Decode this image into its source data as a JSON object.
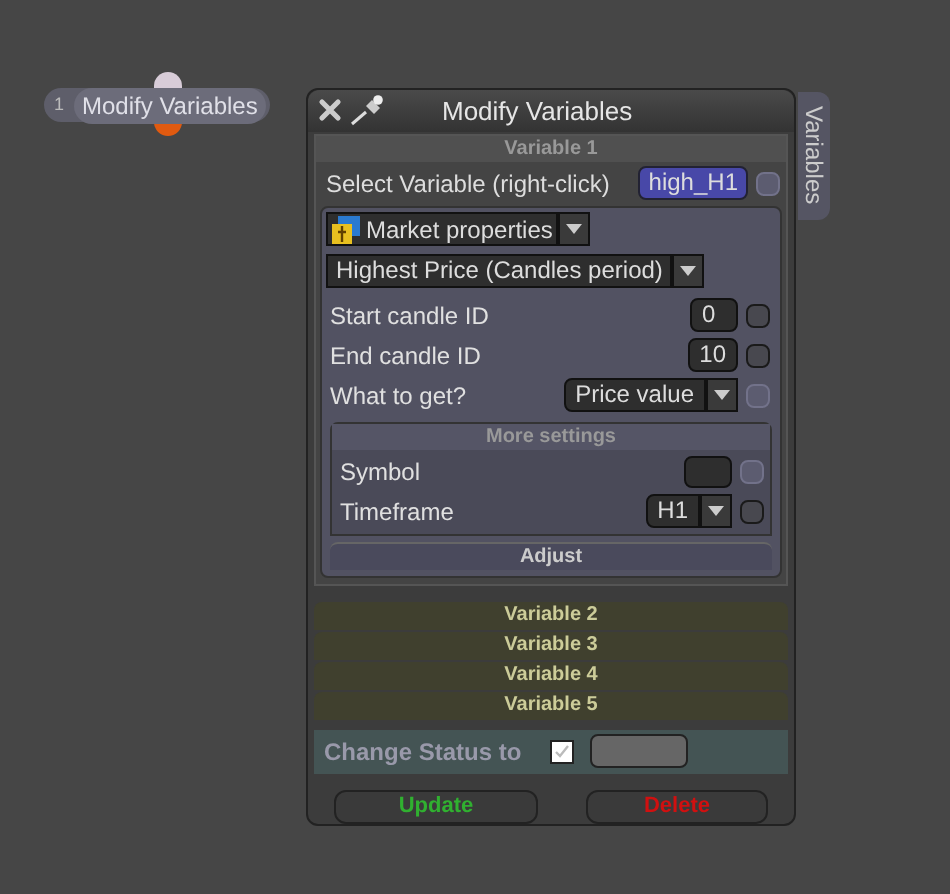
{
  "node": {
    "index": "1",
    "label": "Modify Variables"
  },
  "window": {
    "title": "Modify Variables",
    "side_tab": "Variables"
  },
  "variable_1": {
    "header": "Variable 1",
    "select_label": "Select Variable (right-click)",
    "variable": "high_H1",
    "variable_checkbox": {
      "checked": false,
      "disabled": true
    },
    "source": "Market properties",
    "property": "Highest Price (Candles period)",
    "fields": [
      {
        "kind": "input",
        "label": "Start candle ID",
        "value": "0",
        "checked": false,
        "disabled": false
      },
      {
        "kind": "input",
        "label": "End candle ID",
        "value": "10",
        "checked": false,
        "disabled": false
      },
      {
        "kind": "dropdown",
        "label": "What to get?",
        "value": "Price value",
        "checked": false,
        "disabled": true
      }
    ],
    "more_settings": {
      "header": "More settings",
      "fields": [
        {
          "kind": "input",
          "label": "Symbol",
          "checked": false,
          "disabled": true
        },
        {
          "kind": "dropdown",
          "label": "Timeframe",
          "value": "H1",
          "checked": false,
          "disabled": false
        }
      ]
    },
    "adjust": "Adjust"
  },
  "collapsed": [
    {
      "label": "Variable 2",
      "expanded": false
    },
    {
      "label": "Variable 3",
      "expanded": false
    },
    {
      "label": "Variable 4",
      "expanded": false
    },
    {
      "label": "Variable 5",
      "expanded": false
    }
  ],
  "status": {
    "label": "Change Status to",
    "checked": true
  },
  "buttons": [
    {
      "label": "Update",
      "kind": "update"
    },
    {
      "label": "Delete",
      "kind": "delete"
    }
  ]
}
